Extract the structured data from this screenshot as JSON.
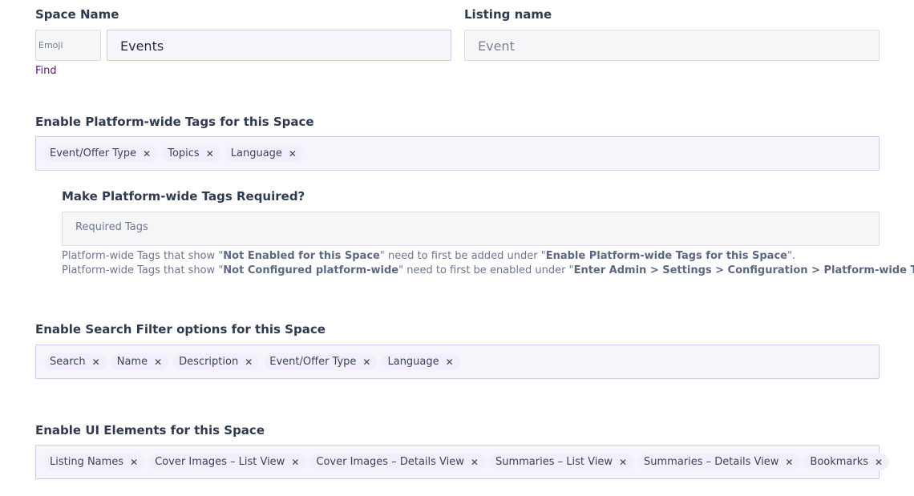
{
  "space_name": {
    "label": "Space Name",
    "emoji_placeholder": "Emoji",
    "value": "Events",
    "find_link": "Find"
  },
  "listing_name": {
    "label": "Listing name",
    "value": "Event"
  },
  "platform_tags": {
    "label": "Enable Platform-wide Tags for this Space",
    "chips": [
      {
        "label": "Event/Offer Type"
      },
      {
        "label": "Topics"
      },
      {
        "label": "Language"
      }
    ]
  },
  "required_tags": {
    "label": "Make Platform-wide Tags Required?",
    "placeholder": "Required Tags",
    "help1": {
      "a": "Platform-wide Tags that show \"",
      "b": "Not Enabled for this Space",
      "c": "\" need to first be added under \"",
      "d": "Enable Platform-wide Tags for this Space",
      "e": "\"."
    },
    "help2": {
      "a": "Platform-wide Tags that show \"",
      "b": "Not Configured platform-wide",
      "c": "\" need to first be enabled under \"",
      "d": "Enter Admin > Settings > Configuration > Platform-wide Tags",
      "e": "\"."
    }
  },
  "search_filters": {
    "label": "Enable Search Filter options for this Space",
    "chips": [
      {
        "label": "Search"
      },
      {
        "label": "Name"
      },
      {
        "label": "Description"
      },
      {
        "label": "Event/Offer Type"
      },
      {
        "label": "Language"
      }
    ]
  },
  "ui_elements": {
    "label": "Enable UI Elements for this Space",
    "chips": [
      {
        "label": "Listing Names"
      },
      {
        "label": "Cover Images – List View"
      },
      {
        "label": "Cover Images – Details View"
      },
      {
        "label": "Summaries – List View"
      },
      {
        "label": "Summaries – Details View"
      },
      {
        "label": "Bookmarks"
      }
    ]
  },
  "icons": {
    "remove": "close-icon"
  }
}
